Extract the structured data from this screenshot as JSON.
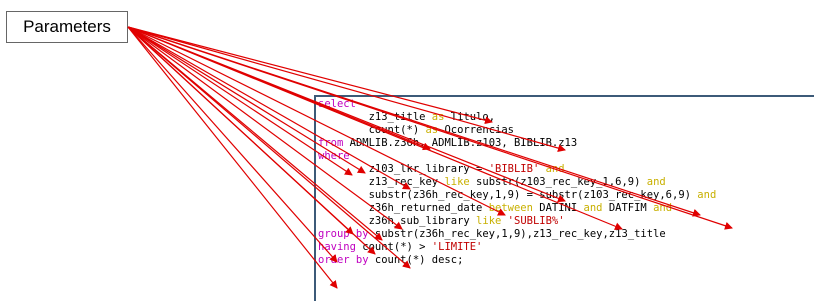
{
  "callout": {
    "label": "Parameters"
  },
  "colors": {
    "arrow": "#e00000",
    "keyword": "#c000c0",
    "string": "#c00000",
    "operator": "#c8b000",
    "panel_border": "#3c5a78"
  },
  "code": {
    "lines": [
      [
        {
          "t": "select",
          "c": "kw"
        }
      ],
      [
        {
          "t": "        z13_title "
        },
        {
          "t": "as",
          "c": "sh"
        },
        {
          "t": " Titulo,"
        }
      ],
      [
        {
          "t": "        count(*) "
        },
        {
          "t": "as",
          "c": "sh"
        },
        {
          "t": " Ocorrencias"
        }
      ],
      [
        {
          "t": "from",
          "c": "kw"
        },
        {
          "t": " ADMLIB.z36h, ADMLIB.z103, BIBLIB.z13"
        }
      ],
      [
        {
          "t": "where",
          "c": "kw"
        }
      ],
      [
        {
          "t": "        z103_lkr_library = "
        },
        {
          "t": "'BIBLIB'",
          "c": "str"
        },
        {
          "t": " "
        },
        {
          "t": "and",
          "c": "sh"
        }
      ],
      [
        {
          "t": "        z13_rec_key "
        },
        {
          "t": "like",
          "c": "sh"
        },
        {
          "t": " substr(z103_rec_key_1,6,9) "
        },
        {
          "t": "and",
          "c": "sh"
        }
      ],
      [
        {
          "t": "        substr(z36h_rec_key,1,9) = substr(z103_rec_key,6,9) "
        },
        {
          "t": "and",
          "c": "sh"
        }
      ],
      [
        {
          "t": "        z36h_returned_date "
        },
        {
          "t": "between",
          "c": "sh"
        },
        {
          "t": " DATINI "
        },
        {
          "t": "and",
          "c": "sh"
        },
        {
          "t": " DATFIM "
        },
        {
          "t": "and",
          "c": "sh"
        }
      ],
      [
        {
          "t": "        z36h_sub_library "
        },
        {
          "t": "like",
          "c": "sh"
        },
        {
          "t": " "
        },
        {
          "t": "'SUBLIB%'",
          "c": "str"
        }
      ],
      [
        {
          "t": "group by",
          "c": "kw"
        },
        {
          "t": " substr(z36h_rec_key,1,9),z13_rec_key,z13_title"
        }
      ],
      [
        {
          "t": "having",
          "c": "kw"
        },
        {
          "t": " count(*) > "
        },
        {
          "t": "'LIMITE'",
          "c": "str"
        }
      ],
      [
        {
          "t": "order by",
          "c": "kw"
        },
        {
          "t": " count(*) desc;"
        }
      ]
    ]
  }
}
